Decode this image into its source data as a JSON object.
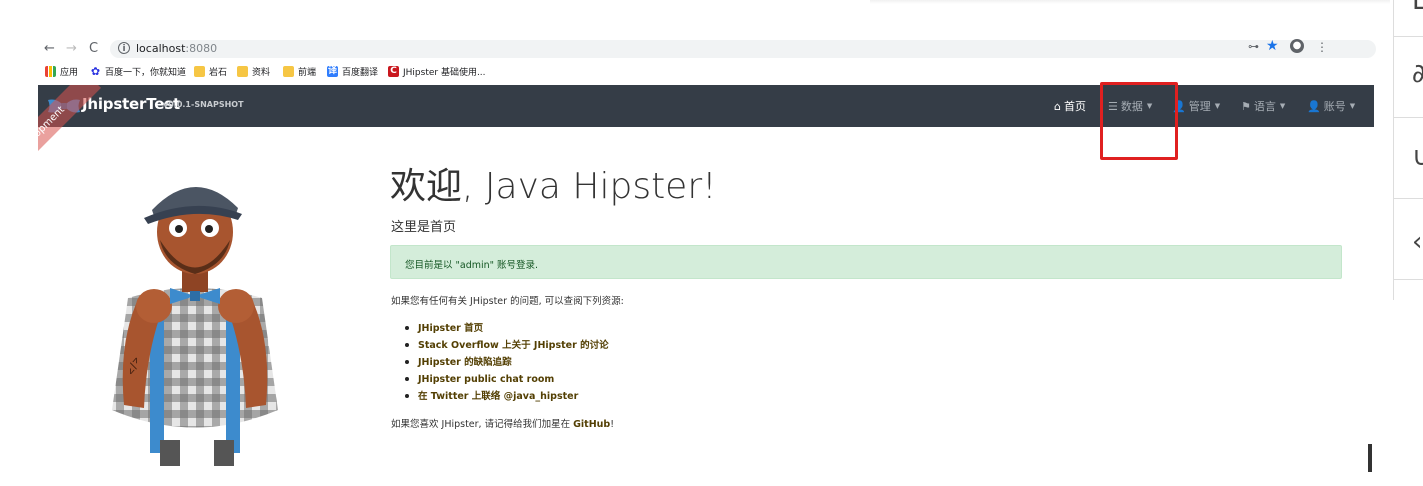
{
  "browser": {
    "url_host": "localhost",
    "url_port": ":8080",
    "bookmarks": [
      {
        "label": "应用",
        "icon": "apps-grid-icon"
      },
      {
        "label": "百度一下，你就知道",
        "icon": "baidu-paw-icon"
      },
      {
        "label": "岩石",
        "icon": "folder-icon"
      },
      {
        "label": "资料",
        "icon": "folder-icon"
      },
      {
        "label": "前端",
        "icon": "folder-icon"
      },
      {
        "label": "百度翻译",
        "icon": "translate-icon"
      },
      {
        "label": "JHipster 基础使用...",
        "icon": "csdn-icon"
      }
    ],
    "translate_glyph": "译",
    "csdn_glyph": "C"
  },
  "navbar": {
    "brand": "JhipsterTest",
    "version": "v0.0.1-SNAPSHOT",
    "ribbon": "Development",
    "items": [
      {
        "label": "首页",
        "icon": "home-icon"
      },
      {
        "label": "数据",
        "icon": "list-icon"
      },
      {
        "label": "管理",
        "icon": "user-plus-icon"
      },
      {
        "label": "语言",
        "icon": "flag-icon"
      },
      {
        "label": "账号",
        "icon": "user-icon"
      }
    ]
  },
  "main": {
    "title_strong": "欢迎",
    "title_rest": ", Java Hipster!",
    "subtitle": "这里是首页",
    "alert": "您目前是以 \"admin\" 账号登录.",
    "intro": "如果您有任何有关 JHipster 的问题, 可以查阅下列资源:",
    "links": [
      "JHipster 首页",
      "Stack Overflow 上关于 JHipster 的讨论",
      "JHipster 的缺陷追踪",
      "JHipster public chat room",
      "在 Twitter 上联络 @java_hipster"
    ],
    "footer_prefix": "如果您喜欢 JHipster, 请记得给我们加星在 ",
    "footer_link": "GitHub",
    "footer_suffix": "!"
  },
  "colors": {
    "navbar_bg": "#353d47",
    "alert_bg": "#d4edda",
    "highlight": "#e02020",
    "link": "#533f03"
  }
}
